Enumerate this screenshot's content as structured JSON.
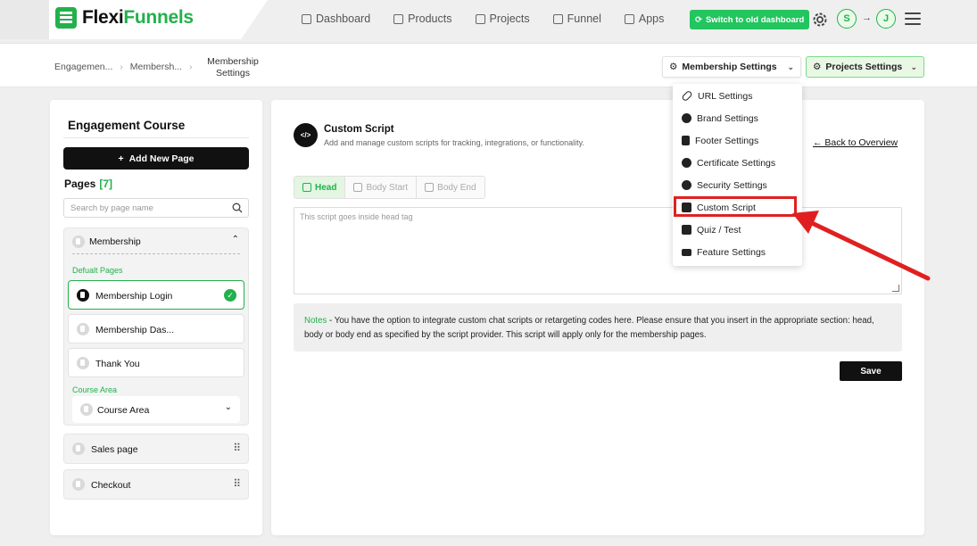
{
  "app": {
    "brand_part1": "Flexi",
    "brand_part2": "Funnels",
    "accent_color": "#22b14c"
  },
  "topnav": {
    "items": [
      {
        "label": "Dashboard",
        "icon": "grid-icon"
      },
      {
        "label": "Products",
        "icon": "store-icon"
      },
      {
        "label": "Projects",
        "icon": "document-icon"
      },
      {
        "label": "Funnel",
        "icon": "funnel-icon"
      },
      {
        "label": "Apps",
        "icon": "apps-icon"
      }
    ],
    "switch_label": "Switch to old dashboard",
    "avatar_1": "S",
    "avatar_2": "J",
    "arrow": "→"
  },
  "breadcrumb": {
    "items": [
      "Engagemen...",
      "Membersh..."
    ],
    "current": "Membership Settings"
  },
  "header_actions": {
    "membership_settings": "Membership Settings",
    "projects_settings": "Projects Settings"
  },
  "sidebar": {
    "course_title": "Engagement Course",
    "add_page": "Add New Page",
    "pages_label": "Pages",
    "pages_count": "[7]",
    "search_placeholder": "Search by page name",
    "membership_group": "Membership",
    "default_pages_label": "Defualt Pages",
    "pages": [
      "Membership Login",
      "Membership Das...",
      "Thank You"
    ],
    "course_area_label": "Course Area",
    "course_area_item": "Course Area",
    "sales_page": "Sales page",
    "checkout": "Checkout"
  },
  "main": {
    "icon_text": "</>",
    "title": "Custom Script",
    "subtitle": "Add and manage custom scripts for tracking, integrations, or functionality.",
    "back_link": "← Back to Overview",
    "tabs": [
      "Head",
      "Body Start",
      "Body End"
    ],
    "script_placeholder": "This script goes inside head tag",
    "notes_label": "Notes",
    "notes_text": " - You have the option to integrate custom chat scripts or retargeting codes here. Please ensure that you insert in the appropriate section: head, body or body end as specified by the script provider. This script will apply only for the membership pages.",
    "save": "Save"
  },
  "dropdown": {
    "items": [
      "URL Settings",
      "Brand Settings",
      "Footer Settings",
      "Certificate Settings",
      "Security Settings",
      "Custom Script",
      "Quiz / Test",
      "Feature Settings"
    ],
    "selected": "Custom Script",
    "highlight_color": "#e02020"
  }
}
